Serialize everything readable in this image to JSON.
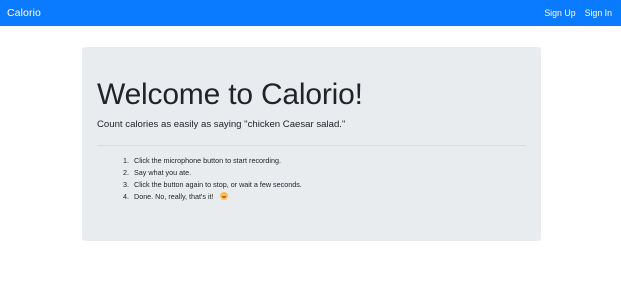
{
  "navbar": {
    "brand": "Calorio",
    "links": [
      {
        "label": "Sign Up"
      },
      {
        "label": "Sign In"
      }
    ],
    "background_color": "#0a7bff"
  },
  "hero": {
    "title": "Welcome to Calorio!",
    "lead": "Count calories as easily as saying \"chicken Caesar salad.\"",
    "background_color": "#e9ecef",
    "steps": [
      {
        "number": "1.",
        "text": "Click the microphone button to start recording."
      },
      {
        "number": "2.",
        "text": "Say what you ate."
      },
      {
        "number": "3.",
        "text": "Click the button again to stop, or wait a few seconds."
      },
      {
        "number": "4.",
        "text": "Done. No, really, that's it!",
        "icon": "laughing-face-emoji-icon"
      }
    ]
  }
}
